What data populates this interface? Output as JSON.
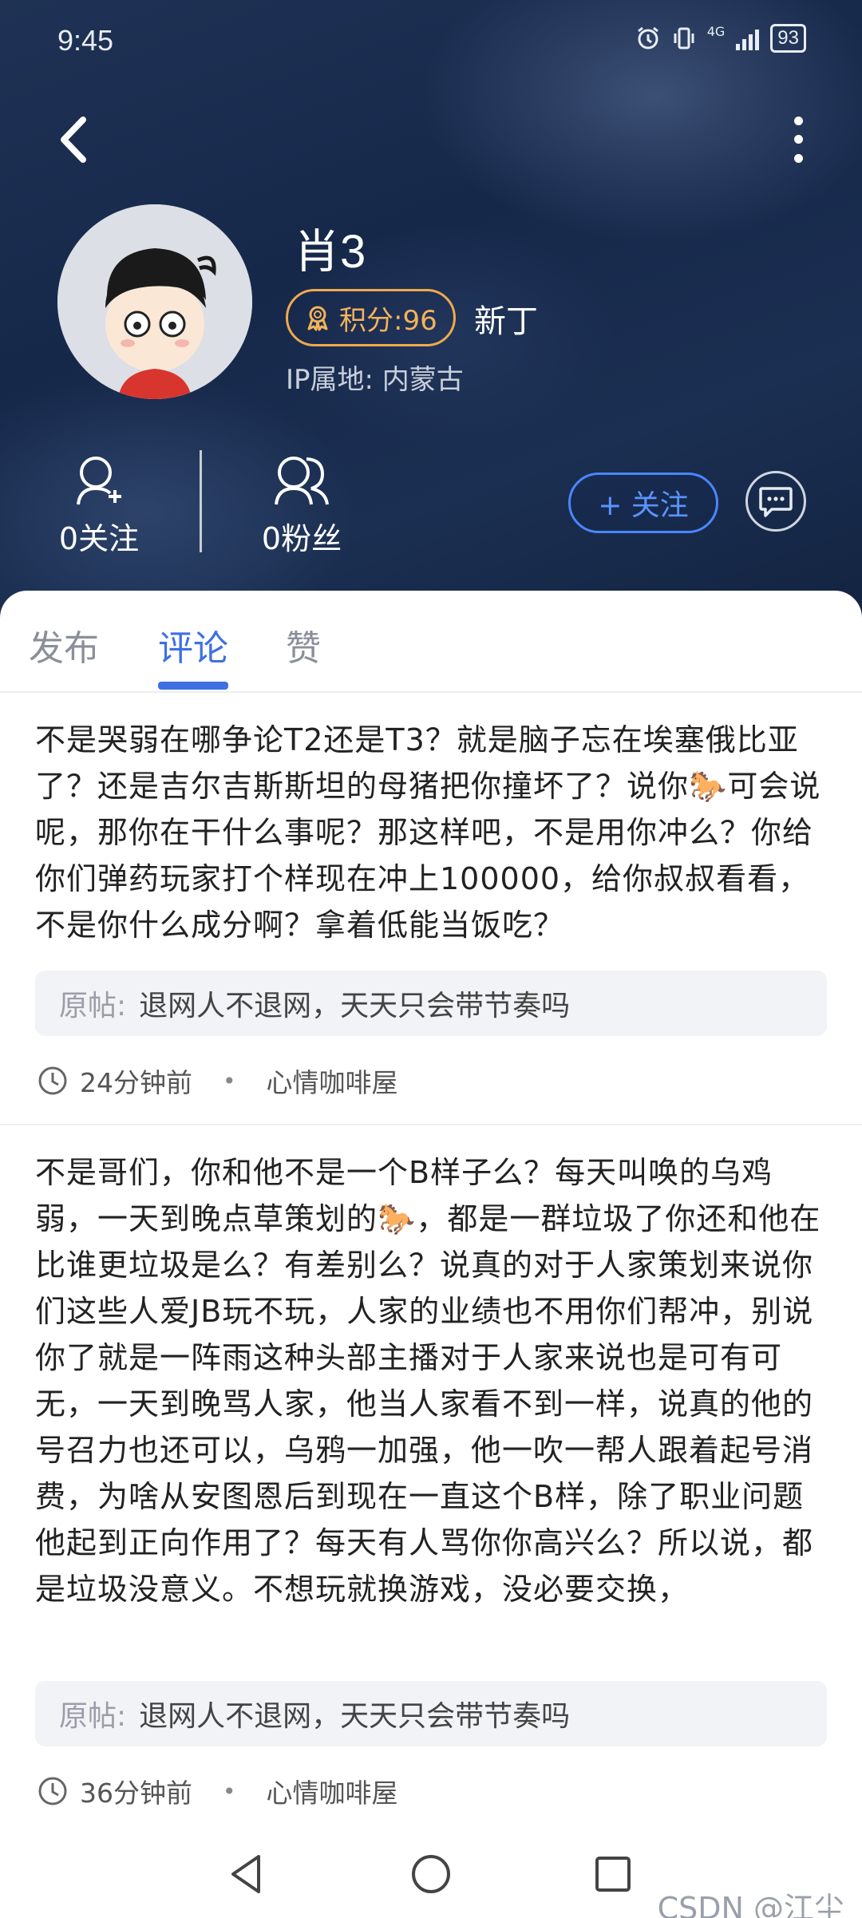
{
  "status_bar": {
    "time": "9:45",
    "network": "4G",
    "battery": "93"
  },
  "profile": {
    "name": "肖3",
    "score_label": "积分:96",
    "rank": "新丁",
    "ip_location": "IP属地: 内蒙古"
  },
  "stats": {
    "following": "0关注",
    "followers": "0粉丝"
  },
  "actions": {
    "follow": "+ 关注"
  },
  "tabs": [
    {
      "label": "发布"
    },
    {
      "label": "评论",
      "active": true
    },
    {
      "label": "赞"
    }
  ],
  "comments": [
    {
      "text": "不是哭弱在哪争论T2还是T3？就是脑子忘在埃塞俄比亚了？还是吉尔吉斯斯坦的母猪把你撞坏了？说你🐎可会说呢，那你在干什么事呢？那这样吧，不是用你冲么？你给你们弹药玩家打个样现在冲上100000，给你叔叔看看，不是你什么成分啊？拿着低能当饭吃？",
      "quote_label": "原帖:",
      "quote_text": "退网人不退网，天天只会带节奏吗",
      "time": "24分钟前",
      "board": "心情咖啡屋"
    },
    {
      "text": "不是哥们，你和他不是一个B样子么？每天叫唤的乌鸡弱，一天到晚点草策划的🐎，都是一群垃圾了你还和他在比谁更垃圾是么？有差别么？说真的对于人家策划来说你们这些人爱JB玩不玩，人家的业绩也不用你们帮冲，别说你了就是一阵雨这种头部主播对于人家来说也是可有可无，一天到晚骂人家，他当人家看不到一样，说真的他的号召力也还可以，乌鸦一加强，他一吹一帮人跟着起号消费，为啥从安图恩后到现在一直这个B样，除了职业问题他起到正向作用了？每天有人骂你你高兴么？所以说，都是垃圾没意义。不想玩就换游戏，没必要交换，",
      "quote_label": "原帖:",
      "quote_text": "退网人不退网，天天只会带节奏吗",
      "time": "36分钟前",
      "board": "心情咖啡屋"
    }
  ],
  "watermark": "CSDN @江尘",
  "colors": {
    "accent": "#3f6fe3",
    "badge": "#f0a94c"
  }
}
